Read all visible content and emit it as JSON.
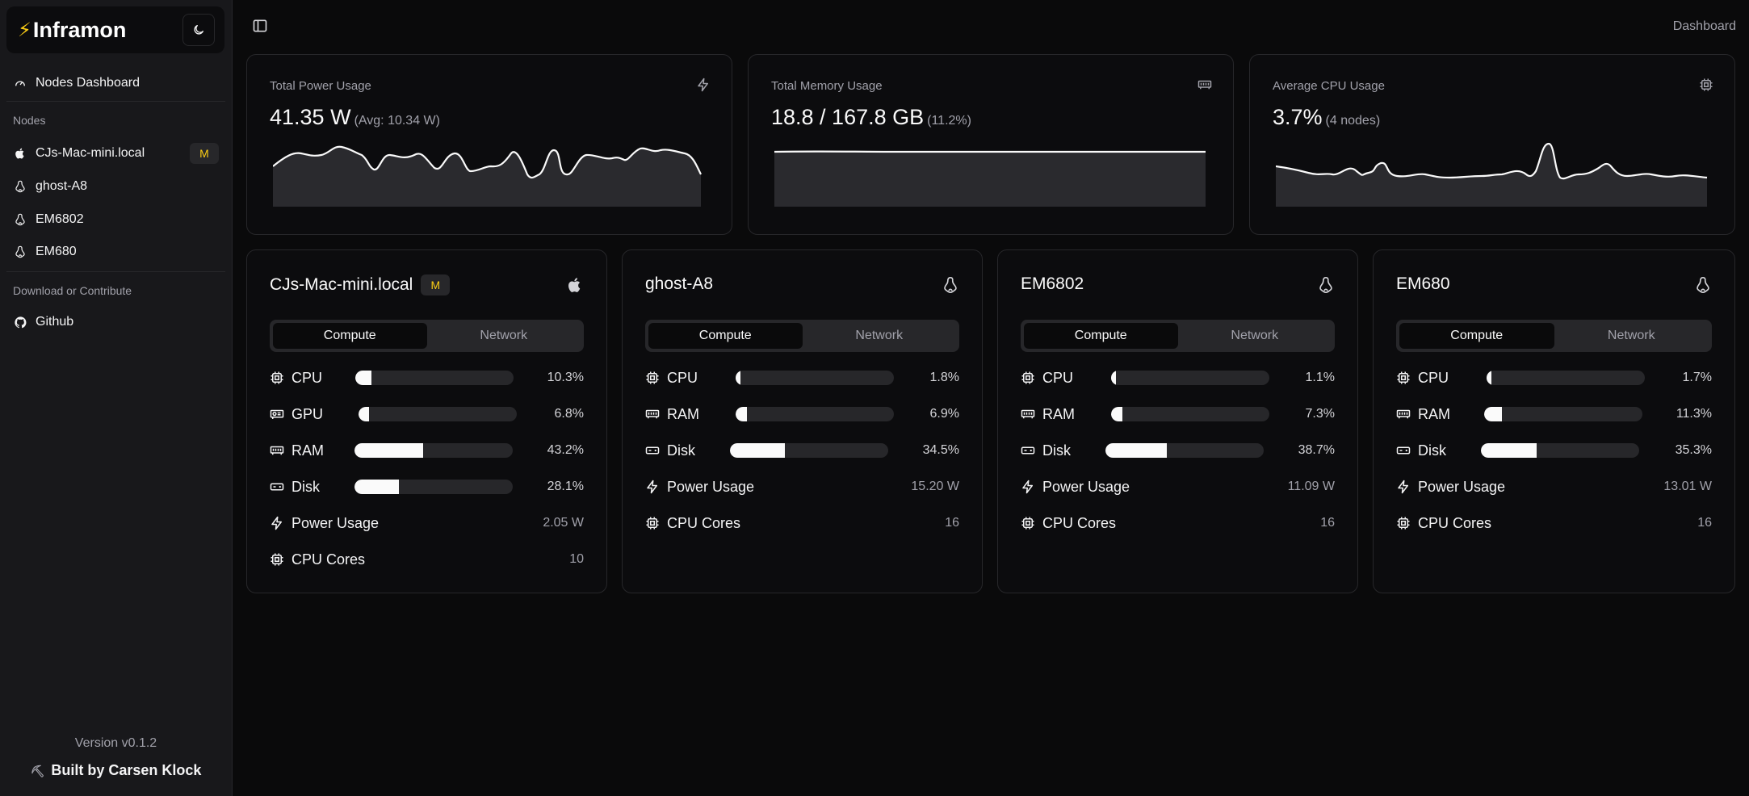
{
  "brand": {
    "name": "Inframon",
    "bolt": "⚡"
  },
  "sidebar": {
    "dashboard_label": "Nodes Dashboard",
    "nodes_group": "Nodes",
    "nodes": [
      {
        "name": "CJs-Mac-mini.local",
        "os": "apple",
        "badge": "M"
      },
      {
        "name": "ghost-A8",
        "os": "linux"
      },
      {
        "name": "EM6802",
        "os": "linux"
      },
      {
        "name": "EM680",
        "os": "linux"
      }
    ],
    "contribute_group": "Download or Contribute",
    "github_label": "Github",
    "version": "Version v0.1.2",
    "built_by": "Built by Carsen Klock",
    "built_icon": "⛏"
  },
  "header": {
    "breadcrumb": "Dashboard"
  },
  "summary": {
    "power": {
      "title": "Total Power Usage",
      "value": "41.35 W",
      "sub": "(Avg: 10.34 W)",
      "icon": "zap-icon"
    },
    "memory": {
      "title": "Total Memory Usage",
      "value": "18.8 / 167.8 GB",
      "sub": "(11.2%)",
      "icon": "memory-icon"
    },
    "cpu": {
      "title": "Average CPU Usage",
      "value": "3.7%",
      "sub": "(4 nodes)",
      "icon": "cpu-icon"
    }
  },
  "tabs": {
    "compute": "Compute",
    "network": "Network"
  },
  "nodes": [
    {
      "name": "CJs-Mac-mini.local",
      "badge": "M",
      "os": "apple",
      "metrics": [
        {
          "label": "CPU",
          "value": "10.3%",
          "pct": 10.3,
          "icon": "cpu"
        },
        {
          "label": "GPU",
          "value": "6.8%",
          "pct": 6.8,
          "icon": "gpu"
        },
        {
          "label": "RAM",
          "value": "43.2%",
          "pct": 43.2,
          "icon": "ram"
        },
        {
          "label": "Disk",
          "value": "28.1%",
          "pct": 28.1,
          "icon": "disk"
        }
      ],
      "power_label": "Power Usage",
      "power": "2.05 W",
      "cores_label": "CPU Cores",
      "cores": "10"
    },
    {
      "name": "ghost-A8",
      "os": "linux",
      "metrics": [
        {
          "label": "CPU",
          "value": "1.8%",
          "pct": 1.8,
          "icon": "cpu"
        },
        {
          "label": "RAM",
          "value": "6.9%",
          "pct": 6.9,
          "icon": "ram"
        },
        {
          "label": "Disk",
          "value": "34.5%",
          "pct": 34.5,
          "icon": "disk"
        }
      ],
      "power_label": "Power Usage",
      "power": "15.20 W",
      "cores_label": "CPU Cores",
      "cores": "16"
    },
    {
      "name": "EM6802",
      "os": "linux",
      "metrics": [
        {
          "label": "CPU",
          "value": "1.1%",
          "pct": 1.1,
          "icon": "cpu"
        },
        {
          "label": "RAM",
          "value": "7.3%",
          "pct": 7.3,
          "icon": "ram"
        },
        {
          "label": "Disk",
          "value": "38.7%",
          "pct": 38.7,
          "icon": "disk"
        }
      ],
      "power_label": "Power Usage",
      "power": "11.09 W",
      "cores_label": "CPU Cores",
      "cores": "16"
    },
    {
      "name": "EM680",
      "os": "linux",
      "metrics": [
        {
          "label": "CPU",
          "value": "1.7%",
          "pct": 1.7,
          "icon": "cpu"
        },
        {
          "label": "RAM",
          "value": "11.3%",
          "pct": 11.3,
          "icon": "ram"
        },
        {
          "label": "Disk",
          "value": "35.3%",
          "pct": 35.3,
          "icon": "disk"
        }
      ],
      "power_label": "Power Usage",
      "power": "13.01 W",
      "cores_label": "CPU Cores",
      "cores": "16"
    }
  ],
  "colors": {
    "accent": "#facc15",
    "bar_fill": "#fafafa",
    "bar_track": "#27272a",
    "card_bg": "#0c0c0e"
  }
}
